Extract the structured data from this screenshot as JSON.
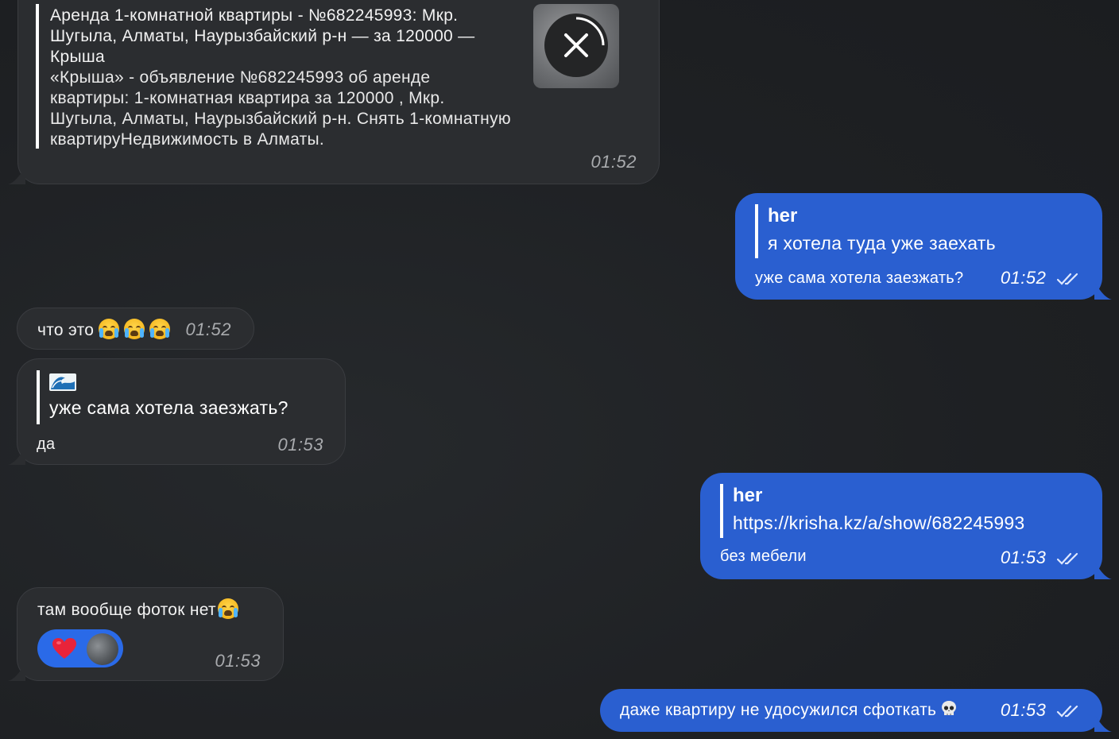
{
  "messages": {
    "m1": {
      "link_title": "Аренда 1-комнатной квартиры - №682245993: Мкр. Шугыла, Алматы, Наурызбайский р-н — за 120000 — Крыша",
      "link_description": "«Крыша» - объявление №682245993 об аренде квартиры: 1-комнатная квартира за 120000 , Мкр. Шугыла, Алматы, Наурызбайский р-н. Снять 1-комнатную квартируНедвижимость в Алматы.",
      "title_lines": [
        "Аренда 1-комнатной квартиры - №682245993: Мкр.",
        "Шугыла, Алматы, Наурызбайский р-н — за 120000 —",
        "Крыша"
      ],
      "desc_lines": [
        "«Крыша» - объявление №682245993 об аренде",
        "квартиры: 1-комнатная квартира за 120000 , Мкр.",
        "Шугыла, Алматы, Наурызбайский р-н. Снять 1-комнатную",
        "квартируНедвижимость в Алматы."
      ],
      "time": "01:52"
    },
    "m2": {
      "quote_author": "her",
      "quote_text": "я хотела туда уже заехать",
      "text": "уже сама хотела заезжать?",
      "time": "01:52"
    },
    "m3": {
      "text": "что это",
      "time": "01:52"
    },
    "m4": {
      "quote_text": "уже сама хотела заезжать?",
      "text": "да",
      "time": "01:53"
    },
    "m5": {
      "quote_author": "her",
      "quote_text": "https://krisha.kz/a/show/682245993",
      "text": "без мебели",
      "time": "01:53"
    },
    "m6": {
      "text": "там вообще фоток нет",
      "reaction": "heart",
      "time": "01:53"
    },
    "m7": {
      "text": "даже квартиру не удосужился сфоткать",
      "time": "01:53"
    }
  },
  "colors": {
    "background": "#1f2124",
    "incoming_bubble": "#2b2d30",
    "outgoing_bubble": "#2a5fd0",
    "reaction_pill": "#2a6ae8",
    "heart": "#e8233a"
  }
}
